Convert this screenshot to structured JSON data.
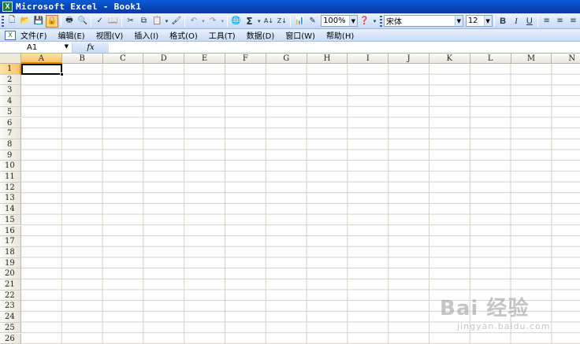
{
  "window": {
    "title": "Microsoft Excel - Book1",
    "app_icon": "excel-icon"
  },
  "toolbar": {
    "zoom": "100%",
    "font_name": "宋体",
    "font_size": "12",
    "sigma_label": "Σ",
    "bold_label": "B",
    "italic_label": "I",
    "underline_label": "U"
  },
  "menu": {
    "items": [
      {
        "label": "文件(F)"
      },
      {
        "label": "编辑(E)"
      },
      {
        "label": "视图(V)"
      },
      {
        "label": "插入(I)"
      },
      {
        "label": "格式(O)"
      },
      {
        "label": "工具(T)"
      },
      {
        "label": "数据(D)"
      },
      {
        "label": "窗口(W)"
      },
      {
        "label": "帮助(H)"
      }
    ]
  },
  "formula_bar": {
    "name_box": "A1",
    "fx_label": "fx",
    "formula": ""
  },
  "sheet": {
    "columns": [
      "A",
      "B",
      "C",
      "D",
      "E",
      "F",
      "G",
      "H",
      "I",
      "J",
      "K",
      "L",
      "M",
      "N"
    ],
    "rows": [
      "1",
      "2",
      "3",
      "4",
      "5",
      "6",
      "7",
      "8",
      "9",
      "10",
      "11",
      "12",
      "13",
      "14",
      "15",
      "16",
      "17",
      "18",
      "19",
      "20",
      "21",
      "22",
      "23",
      "24",
      "25",
      "26"
    ],
    "active_cell": "A1"
  },
  "watermark": {
    "main": "Bai 经验",
    "sub": "jingyan.baidu.com"
  }
}
